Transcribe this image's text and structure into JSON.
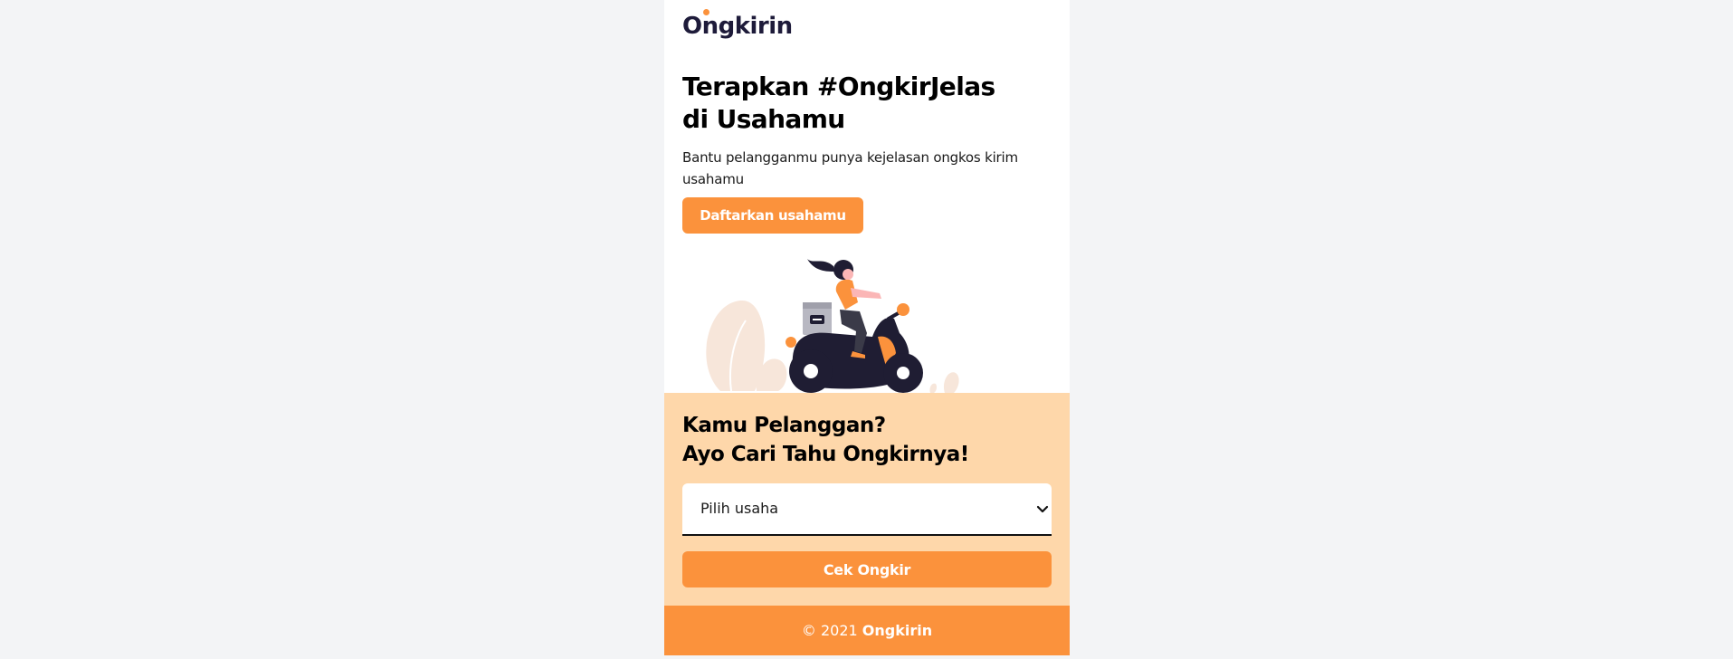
{
  "header": {
    "logo_text": "Ongkirin"
  },
  "hero": {
    "title_line1": "Terapkan #OngkirJelas",
    "title_line2": "di Usahamu",
    "subtitle": "Bantu pelangganmu punya kejelasan ongkos kirim usahamu",
    "register_button": "Daftarkan usahamu"
  },
  "customer": {
    "title_line1": "Kamu Pelanggan?",
    "title_line2": "Ayo Cari Tahu Ongkirnya!",
    "select_value": "Pilih usaha",
    "check_button": "Cek Ongkir"
  },
  "footer": {
    "copyright": "© 2021",
    "brand": "Ongkirin"
  },
  "colors": {
    "accent": "#fb923c",
    "accent_light": "#fed7aa",
    "logo": "#1e1b3a",
    "background": "#f3f4f6"
  },
  "icons": {
    "select_chevron": "chevron-down-icon"
  }
}
